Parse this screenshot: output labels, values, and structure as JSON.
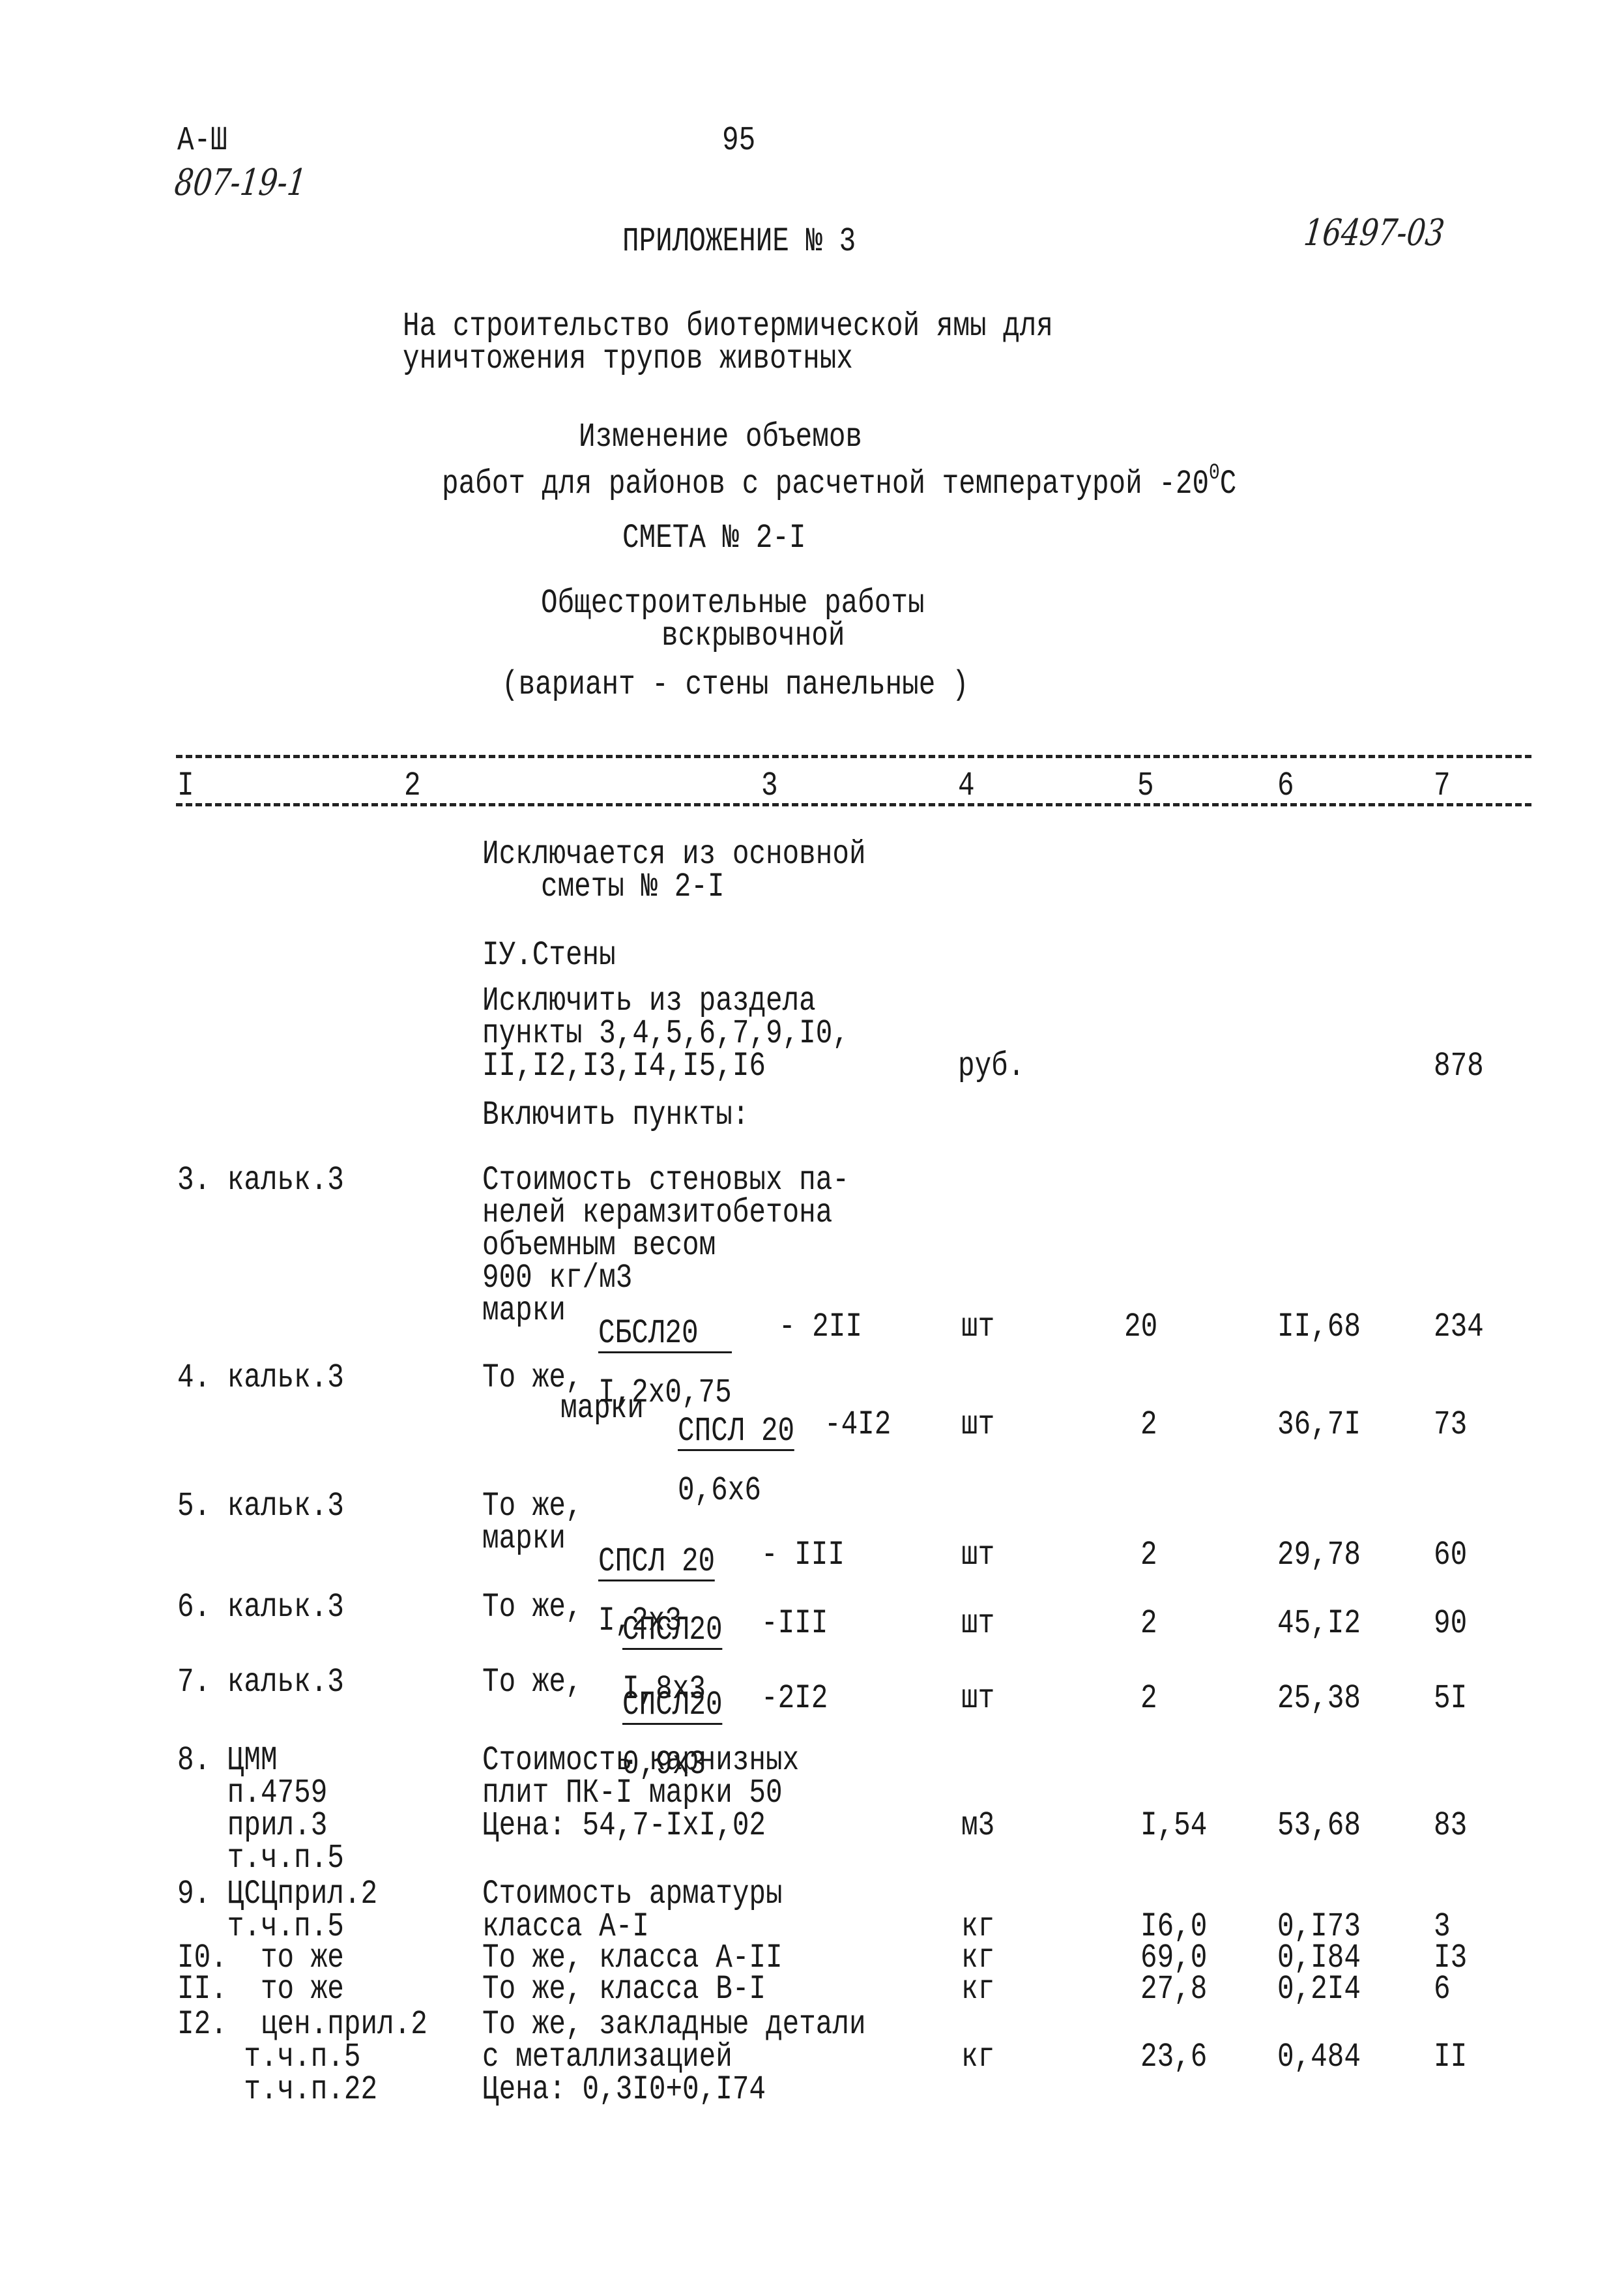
{
  "header": {
    "series_code": "А-Ш",
    "doc_number_handwritten": "807-19-1",
    "page_number": "95",
    "appendix_title": "ПРИЛОЖЕНИЕ № 3",
    "inventory_handwritten": "16497-03"
  },
  "title": {
    "project_line1": "На строительство биотермической ямы для",
    "project_line2": "уничтожения трупов животных",
    "change_line1": "Изменение объемов",
    "change_line2_prefix": "работ для районов с расчетной температурой -20",
    "change_line2_sup": "0",
    "change_line2_suffix": "С",
    "estimate": "СМЕТА № 2-I",
    "works_line1": "Общестроительные работы",
    "works_line2": "вскрывочной",
    "variant": "(вариант - стены панельные )"
  },
  "table": {
    "column_numbers": [
      "I",
      "2",
      "3",
      "4",
      "5",
      "6",
      "7"
    ],
    "excluded_heading_line1": "Исключается из основной",
    "excluded_heading_line2": "сметы № 2-I",
    "section": "IУ.Стены",
    "exclude_line1": "Исключить из раздела",
    "exclude_line2": "пункты 3,4,5,6,7,9,I0,",
    "exclude_line3": "II,I2,I3,I4,I5,I6",
    "exclude_unit": "руб.",
    "exclude_total": "878",
    "include_heading": "Включить пункты:",
    "rows": [
      {
        "ref": "3. кальк.3",
        "desc_lines": [
          "Стоимость стеновых па-",
          "нелей керамзитобетона",
          "объемным весом",
          "900 кг/м3"
        ],
        "mark_prefix": "марки",
        "mark_num": "СБСЛ20",
        "mark_den": "I,2x0,75",
        "mark_suffix": "- 2II",
        "unit": "шт",
        "qty": "20",
        "price": "II,68",
        "total": "234"
      },
      {
        "ref": "4. кальк.3",
        "desc_lines": [
          "То же,"
        ],
        "mark_prefix": "марки",
        "mark_num": "СПСЛ 20",
        "mark_den": "0,6х6",
        "mark_suffix": "-4I2",
        "unit": "шт",
        "qty": "2",
        "price": "36,7I",
        "total": "73"
      },
      {
        "ref": "5. кальк.3",
        "desc_lines": [
          "То же,"
        ],
        "mark_prefix": "марки",
        "mark_num": "СПСЛ 20",
        "mark_den": "I,2х3",
        "mark_suffix": "- III",
        "unit": "шт",
        "qty": "2",
        "price": "29,78",
        "total": "60"
      },
      {
        "ref": "6. кальк.3",
        "desc_lines": [],
        "mark_prefix": "То же,",
        "mark_num": "СПСЛ20",
        "mark_den": "I,8х3",
        "mark_suffix": "-III",
        "unit": "шт",
        "qty": "2",
        "price": "45,I2",
        "total": "90"
      },
      {
        "ref": "7. кальк.3",
        "desc_lines": [],
        "mark_prefix": "То же,",
        "mark_num": "СПСЛ20",
        "mark_den": "0,9х3",
        "mark_suffix": "-2I2",
        "unit": "шт",
        "qty": "2",
        "price": "25,38",
        "total": "5I"
      },
      {
        "ref_lines": [
          "8. ЦММ",
          "   п.4759",
          "   прил.3",
          "   т.ч.п.5"
        ],
        "desc_lines": [
          "Стоимость карнизных",
          "плит ПК-I марки 50",
          "Цена: 54,7-IxI,02"
        ],
        "unit": "м3",
        "qty": "I,54",
        "price": "53,68",
        "total": "83"
      },
      {
        "ref_lines": [
          "9. ЦСЦприл.2",
          "   т.ч.п.5"
        ],
        "desc_lines": [
          "Стоимость арматуры",
          "класса А-I"
        ],
        "unit": "кг",
        "qty": "I6,0",
        "price": "0,I73",
        "total": "3"
      },
      {
        "ref_lines": [
          "I0.  то же"
        ],
        "desc_lines": [
          "То же, класса А-II"
        ],
        "unit": "кг",
        "qty": "69,0",
        "price": "0,I84",
        "total": "I3"
      },
      {
        "ref_lines": [
          "II.  то же"
        ],
        "desc_lines": [
          "То же, класса В-I"
        ],
        "unit": "кг",
        "qty": "27,8",
        "price": "0,2I4",
        "total": "6"
      },
      {
        "ref_lines": [
          "I2.  цен.прил.2",
          "    т.ч.п.5",
          "    т.ч.п.22"
        ],
        "desc_lines": [
          "То же, закладные детали",
          "с металлизацией",
          "Цена: 0,3I0+0,I74"
        ],
        "unit": "кг",
        "qty": "23,6",
        "price": "0,484",
        "total": "II"
      }
    ]
  }
}
